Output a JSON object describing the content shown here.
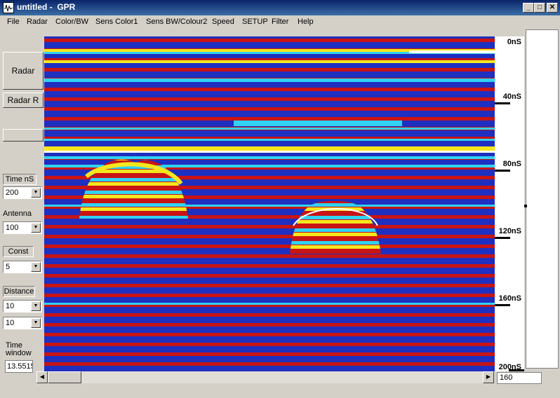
{
  "window": {
    "title": "untitled -  GPR",
    "minimize_glyph": "_",
    "maximize_glyph": "□",
    "close_glyph": "✕"
  },
  "menu": [
    "File",
    "Radar",
    "Color/BW",
    "Sens Color1",
    "Sens BW/Colour2",
    "Speed",
    "SETUP",
    "Filter",
    "Help"
  ],
  "left_panel": {
    "radar_button": "Radar",
    "radar_r_button": "Radar R",
    "time_label": "Time nS",
    "time_value": "200",
    "antenna_label": "Antenna",
    "antenna_value": "100",
    "const_label": "Const",
    "const_value": "5",
    "distance_label": "Distance",
    "distance_value": "10",
    "distance_value2": "10",
    "time_window_label": "Time window",
    "time_window_value": "13.5515"
  },
  "axis": {
    "ticks": [
      "0nS",
      "40nS",
      "80nS",
      "120nS",
      "160nS",
      "200nS"
    ]
  },
  "bottom": {
    "value": "160"
  },
  "colors": {
    "deep_blue": "#1f2fbf",
    "red": "#c81414",
    "cyan": "#31d2f2",
    "yellow": "#f5e61e",
    "white": "#ffffff"
  }
}
